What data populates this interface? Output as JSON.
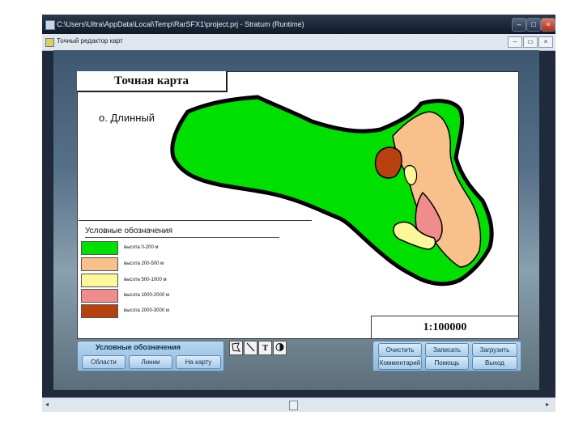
{
  "window": {
    "title": "C:\\Users\\Ultra\\AppData\\Local\\Temp\\RarSFX1\\project.prj - Stratum (Runtime)",
    "inner_title": "Точный редактор карт"
  },
  "map": {
    "title": "Точная карта",
    "island_name": "о. Длинный",
    "scale": "1:100000",
    "colors": {
      "zone_0_200": "#00e000",
      "zone_200_500": "#f8c08a",
      "zone_500_1000": "#fbf79a",
      "zone_1000_2000": "#f08c8c",
      "zone_2000_3000": "#b8420f",
      "outline": "#000000"
    }
  },
  "legend": {
    "title": "Условные обозначения",
    "items": [
      {
        "label": "высота 0-200 м",
        "color": "#00e000"
      },
      {
        "label": "высота 200-500 м",
        "color": "#f8c08a"
      },
      {
        "label": "высота 500-1000 м",
        "color": "#fbf79a"
      },
      {
        "label": "высота 1000-2000 м",
        "color": "#f08c8c"
      },
      {
        "label": "высота 2000-3000 м",
        "color": "#b8420f"
      }
    ]
  },
  "legend_panel": {
    "title": "Условные обозначения",
    "buttons": {
      "areas": "Области",
      "lines": "Линии",
      "to_map": "На карту"
    }
  },
  "tools": {
    "text": "T"
  },
  "action_panel": {
    "clear": "Очистить",
    "save": "Записать",
    "load": "Загрузить",
    "comment": "Комментарий",
    "help": "Помощь",
    "exit": "Выход"
  }
}
